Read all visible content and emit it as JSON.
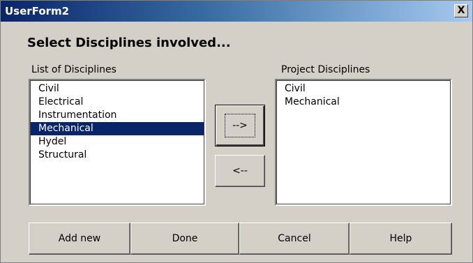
{
  "window": {
    "title": "UserForm2",
    "close_label": "X"
  },
  "heading": "Select Disciplines involved...",
  "left_list": {
    "label": "List of Disciplines",
    "items": [
      "Civil",
      "Electrical",
      "Instrumentation",
      "Mechanical",
      "Hydel",
      "Structural"
    ],
    "selected_index": 3
  },
  "right_list": {
    "label": "Project Disciplines",
    "items": [
      "Civil",
      "Mechanical"
    ]
  },
  "move_buttons": {
    "add": "-->",
    "remove": "<--"
  },
  "bottom_buttons": {
    "add_new": "Add new",
    "done": "Done",
    "cancel": "Cancel",
    "help": "Help"
  },
  "colors": {
    "selection": "#0a246a",
    "face": "#d4d0c8",
    "title_start": "#0a246a",
    "title_end": "#a6caf0"
  }
}
